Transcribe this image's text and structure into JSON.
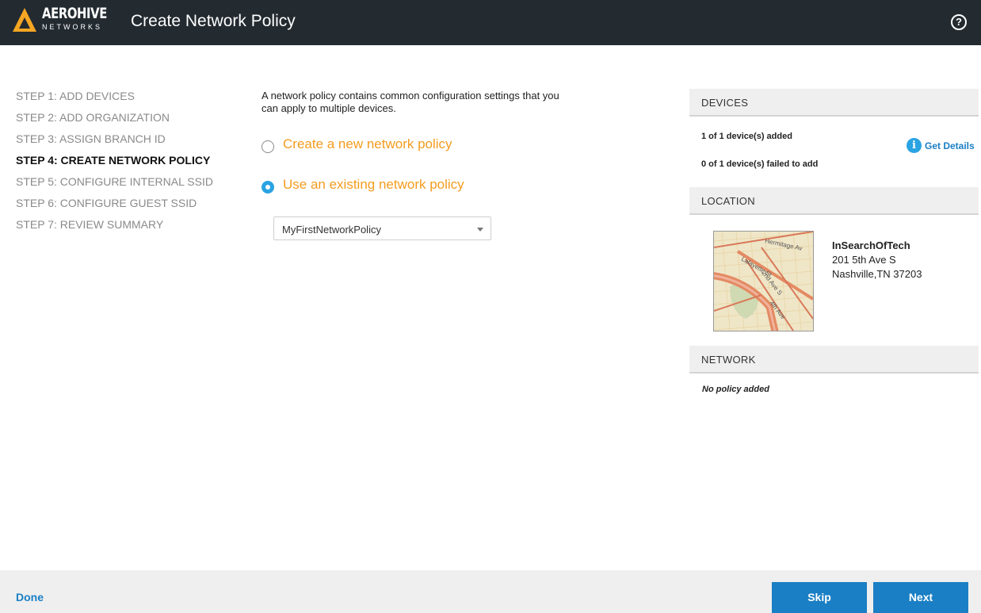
{
  "header": {
    "logo_name": "AEROHIVE",
    "logo_sub": "NETWORKS",
    "title": "Create Network Policy",
    "help_icon": "?"
  },
  "steps": [
    {
      "label": "STEP 1: ADD DEVICES",
      "active": false
    },
    {
      "label": "STEP 2: ADD ORGANIZATION",
      "active": false
    },
    {
      "label": "STEP 3: ASSIGN BRANCH ID",
      "active": false
    },
    {
      "label": "STEP 4: CREATE NETWORK POLICY",
      "active": true
    },
    {
      "label": "STEP 5: CONFIGURE INTERNAL SSID",
      "active": false
    },
    {
      "label": "STEP 6: CONFIGURE GUEST SSID",
      "active": false
    },
    {
      "label": "STEP 7: REVIEW SUMMARY",
      "active": false
    }
  ],
  "main": {
    "description": "A network policy contains common configuration settings that you can apply to multiple devices.",
    "options": [
      {
        "label": "Create a new network policy",
        "selected": false
      },
      {
        "label": "Use an existing network policy",
        "selected": true
      }
    ],
    "policy_select": {
      "value": "MyFirstNetworkPolicy"
    }
  },
  "devices": {
    "heading": "DEVICES",
    "added": "1 of 1 device(s) added",
    "failed": "0 of 1 device(s) failed to add",
    "details_icon": "i",
    "details_label": "Get Details"
  },
  "location": {
    "heading": "LOCATION",
    "name": "InSearchOfTech",
    "street": "201 5th Ave S",
    "city": "Nashville,TN 37203",
    "map_streets": [
      "Hermitage Av",
      "Lafayette St",
      "2nd Ave S",
      "4th Ave"
    ]
  },
  "network": {
    "heading": "NETWORK",
    "status": "No policy added"
  },
  "footer": {
    "done_label": "Done",
    "skip_label": "Skip",
    "next_label": "Next"
  },
  "colors": {
    "header_bg": "#232a30",
    "accent_blue": "#1a7fc4",
    "option_orange": "#f39c1f",
    "radio_blue": "#2aa3e2"
  }
}
